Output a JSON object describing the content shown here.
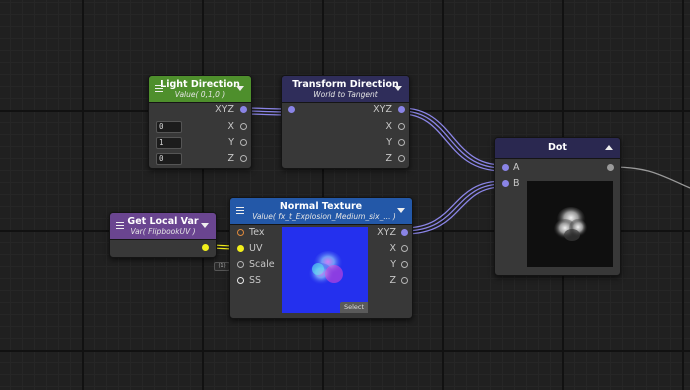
{
  "colors": {
    "light_direction_header": "#4e8f2c",
    "transform_header": "#2f2d5a",
    "dot_header": "#2a2850",
    "normal_texture_header": "#2358a8",
    "get_local_var_header": "#6a4590",
    "vector_wire": "#8a84e6",
    "float_wire": "#f2ef1b",
    "output_wire": "#9a9a9a"
  },
  "nodes": {
    "light_direction": {
      "title": "Light Direction",
      "subtitle": "Value( 0,1,0 )",
      "output_label": "XYZ",
      "inputs": [
        {
          "label": "X",
          "value": "0"
        },
        {
          "label": "Y",
          "value": "1"
        },
        {
          "label": "Z",
          "value": "0"
        }
      ]
    },
    "transform_direction": {
      "title": "Transform Direction",
      "subtitle": "World to Tangent",
      "output_label": "XYZ",
      "outputs": [
        "X",
        "Y",
        "Z"
      ]
    },
    "dot": {
      "title": "Dot",
      "inputs": [
        "A",
        "B"
      ]
    },
    "get_local_var": {
      "title": "Get Local Var",
      "subtitle": "Var( FlipbookUV )",
      "tag": "(1)"
    },
    "normal_texture": {
      "title": "Normal Texture",
      "subtitle": "Value( fx_t_Explosion_Medium_six_... )",
      "inputs": [
        "Tex",
        "UV",
        "Scale",
        "SS"
      ],
      "output_label": "XYZ",
      "outputs": [
        "X",
        "Y",
        "Z"
      ],
      "select_label": "Select"
    }
  }
}
